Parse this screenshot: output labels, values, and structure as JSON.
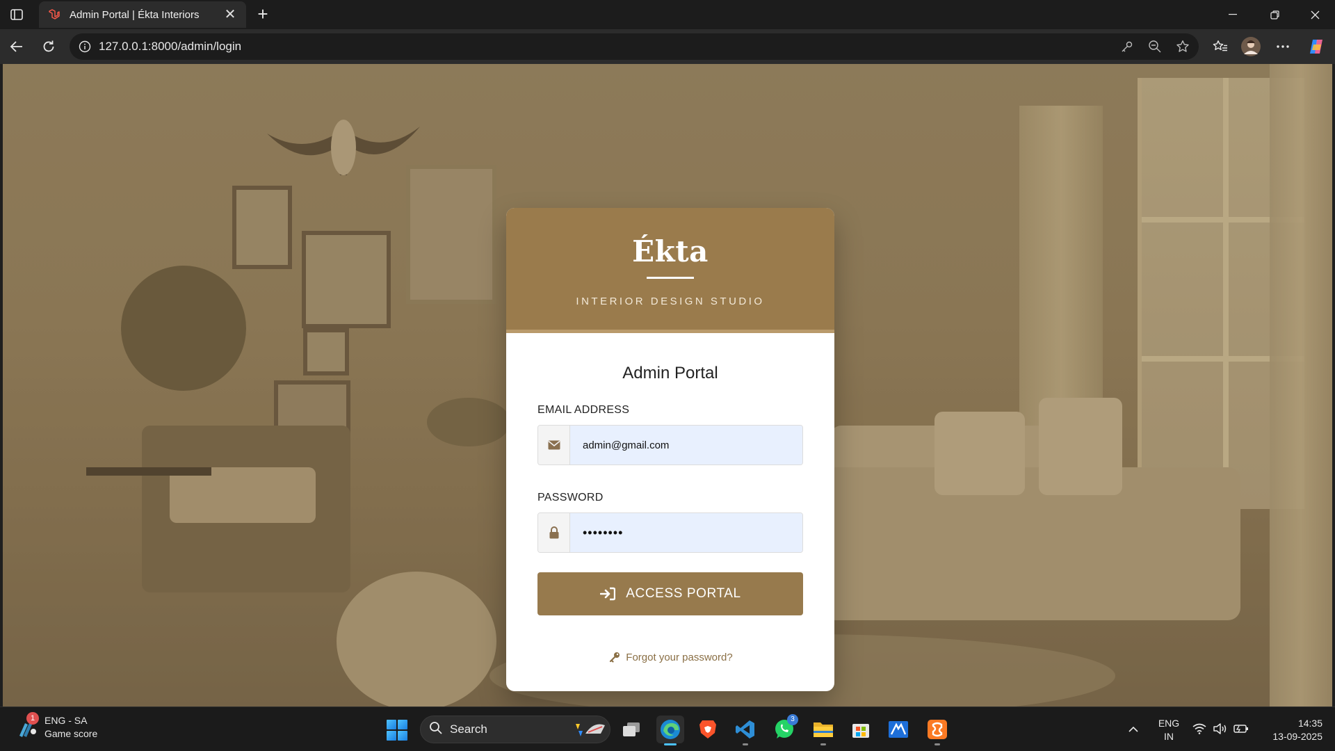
{
  "browser": {
    "tab_title": "Admin Portal | Ékta Interiors",
    "tab_close": "✕",
    "new_tab": "+",
    "url": "127.0.0.1:8000/admin/login"
  },
  "login": {
    "brand": "Ékta",
    "tagline": "INTERIOR DESIGN STUDIO",
    "portal_title": "Admin Portal",
    "email_label": "EMAIL ADDRESS",
    "email_value": "admin@gmail.com",
    "password_label": "PASSWORD",
    "password_value": "••••••••",
    "submit_label": "ACCESS PORTAL",
    "forgot_label": "Forgot your password?"
  },
  "taskbar": {
    "widget_badge": "1",
    "widget_line1": "ENG - SA",
    "widget_line2": "Game score",
    "search_label": "Search",
    "whatsapp_badge": "3",
    "lang_line1": "ENG",
    "lang_line2": "IN",
    "time": "14:35",
    "date": "13-09-2025"
  },
  "colors": {
    "brand_gold": "#9a7b4c",
    "button_gold": "#977a4d",
    "link_gold": "#8a6f45",
    "input_fill": "#e8f0fe"
  }
}
